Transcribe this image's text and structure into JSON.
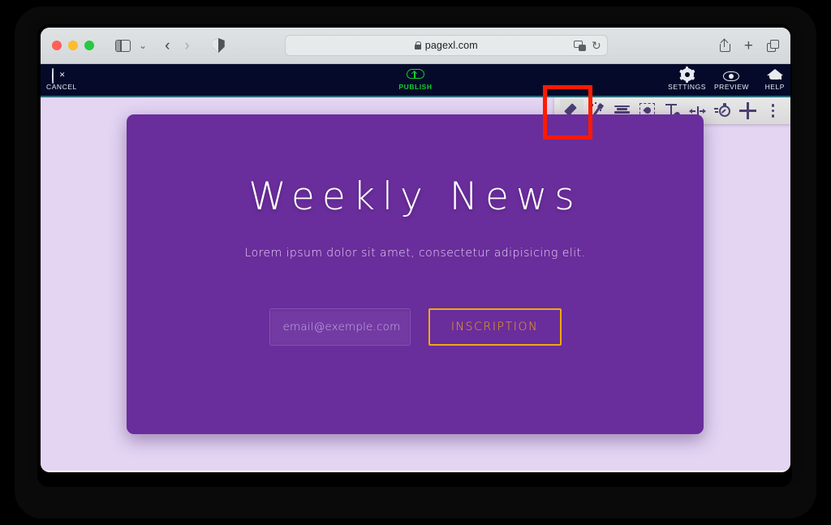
{
  "browser": {
    "traffic_lights": [
      "close",
      "minimize",
      "zoom"
    ],
    "sidebar_toggle": "sidebar-toggle",
    "tab_group_chevron": "⌄",
    "back_arrow": "‹",
    "forward_arrow": "›",
    "privacy_report": "shield-icon",
    "url": "pagexl.com",
    "url_lock": "lock-icon",
    "translate": "translate-icon",
    "reload": "↻",
    "share": "share-icon",
    "new_tab": "+",
    "tab_overview": "tab-overview-icon"
  },
  "app_header": {
    "cancel": {
      "label": "CANCEL",
      "icon": "delete-backspace-icon"
    },
    "publish": {
      "label": "PUBLISH",
      "icon": "cloud-upload-icon",
      "color": "#12d12a"
    },
    "settings": {
      "label": "SETTINGS",
      "icon": "gear-icon"
    },
    "preview": {
      "label": "PREVIEW",
      "icon": "eye-icon"
    },
    "help": {
      "label": "HELP",
      "icon": "graduation-cap-icon"
    }
  },
  "editor_toolbar": {
    "items": [
      {
        "name": "edit",
        "icon": "pencil-icon",
        "active": true
      },
      {
        "name": "magic",
        "icon": "magic-wand-icon",
        "active": false
      },
      {
        "name": "align",
        "icon": "text-align-icon",
        "active": false
      },
      {
        "name": "background-color",
        "icon": "fill-color-icon",
        "active": false
      },
      {
        "name": "text-color",
        "icon": "text-color-icon",
        "active": false
      },
      {
        "name": "spacing",
        "icon": "horizontal-spacing-icon",
        "active": false
      },
      {
        "name": "animation",
        "icon": "stopwatch-icon",
        "active": false
      },
      {
        "name": "add",
        "icon": "plus-icon",
        "active": false
      },
      {
        "name": "more",
        "icon": "kebab-menu-icon",
        "active": false
      }
    ]
  },
  "hero": {
    "title": "Weekly News",
    "subtitle": "Lorem ipsum dolor sit amet, consectetur adipisicing elit.",
    "email_placeholder": "email@exemple.com",
    "submit_label": "INSCRIPTION",
    "card_color": "#6a2d9c",
    "page_background": "#e4d5f3",
    "accent_color": "#f0a80e"
  },
  "annotation": {
    "highlight_target": "pencil-icon",
    "highlight_color": "#ff1a00"
  }
}
